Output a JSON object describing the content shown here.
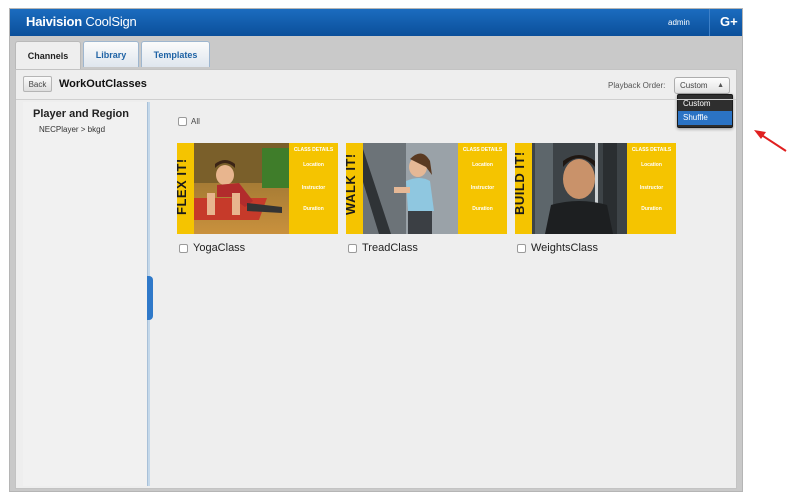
{
  "header": {
    "brand_strong": "Haivision",
    "brand_light": " CoolSign",
    "user": "admin",
    "logout_glyph": "G+"
  },
  "tabs": [
    {
      "label": "Channels",
      "active": true
    },
    {
      "label": "Library",
      "active": false
    },
    {
      "label": "Templates",
      "active": false
    }
  ],
  "toolbar": {
    "back_label": "Back",
    "title": "WorkOutClasses",
    "playback_label": "Playback Order:",
    "playback_value": "Custom",
    "options": [
      "Custom",
      "Shuffle"
    ],
    "selected_option": "Shuffle"
  },
  "left": {
    "title": "Player and Region",
    "path": "NECPlayer > bkgd"
  },
  "main": {
    "all_label": "All",
    "items": [
      {
        "name": "YogaClass",
        "banner": "FLEX IT!"
      },
      {
        "name": "TreadClass",
        "banner": "WALK IT!"
      },
      {
        "name": "WeightsClass",
        "banner": "BUILD IT!"
      }
    ],
    "details": {
      "header": "CLASS DETAILS",
      "location": "Location",
      "instructor": "Instructor",
      "duration": "Duration"
    }
  },
  "colors": {
    "accent": "#1b6cbf",
    "banner": "#f5c400",
    "arrow": "#e02020"
  }
}
